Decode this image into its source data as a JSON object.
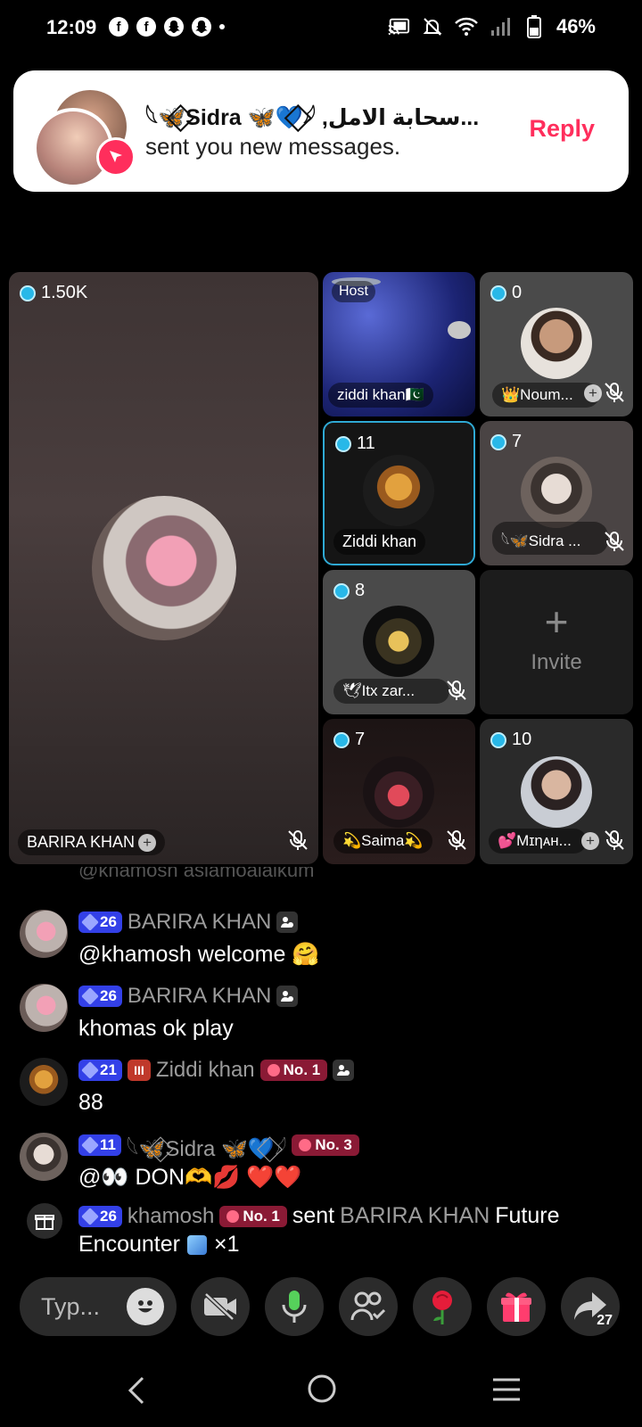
{
  "status_bar": {
    "time": "12:09",
    "battery": "46%"
  },
  "notification": {
    "title": "𓆩🦋⃟Sidra 🦋💙⃟𓆪 ,سحابة الامل...",
    "body": "sent you new messages.",
    "reply_label": "Reply"
  },
  "seats": {
    "main": {
      "count": "1.50K",
      "name": "BARIRA KHAN"
    },
    "host": {
      "label": "Host",
      "name": "ziddi khan🇵🇰"
    },
    "s1": {
      "count": "0",
      "name": "👑Noum..."
    },
    "s2": {
      "count": "11",
      "name": "Ziddi khan"
    },
    "s3": {
      "count": "7",
      "name": "𓆩🦋Sidra ..."
    },
    "s4": {
      "count": "8",
      "name": "🕊Itx zar..."
    },
    "invite": {
      "label": "Invite"
    },
    "s5": {
      "count": "7",
      "name": "💫Saima💫"
    },
    "s6": {
      "count": "10",
      "name": "💕Mɪηᴀн..."
    }
  },
  "chat": {
    "partial_text": "@khamosh aslamoalaikum",
    "messages": [
      {
        "level": "26",
        "name": "BARIRA KHAN",
        "text": "@khamosh welcome 🤗"
      },
      {
        "level": "26",
        "name": "BARIRA KHAN",
        "text": "khomas ok play"
      },
      {
        "level": "21",
        "name": "Ziddi khan",
        "rank": "No. 1",
        "text": "88"
      },
      {
        "level": "11",
        "name": "𓆩🦋⃟Sidra 🦋💙⃟𓆪",
        "rank": "No. 3",
        "text": "@👀 DON🫶💋 ❤️❤️"
      }
    ],
    "gift": {
      "level": "26",
      "sender": "khamosh",
      "rank": "No. 1",
      "verb": "sent",
      "receiver": "BARIRA KHAN",
      "gift_name": "Future",
      "line2": "Encounter",
      "quantity": "×1"
    }
  },
  "toolbar": {
    "input_placeholder": "Typ...",
    "share_count": "27"
  },
  "icons": [
    "facebook-icon",
    "snapchat-icon",
    "cast-icon",
    "mute-bell-icon",
    "wifi-icon",
    "signal-icon",
    "battery-icon",
    "mic-off-icon",
    "plus-icon",
    "emoji-icon",
    "video-off-icon",
    "mic-icon",
    "people-icon",
    "rose-icon",
    "gift-icon",
    "share-icon",
    "back-icon",
    "home-icon",
    "recents-icon"
  ],
  "colors": {
    "accent": "#ff2e5c",
    "coin": "#28b8e8",
    "level": "#3340e8"
  }
}
